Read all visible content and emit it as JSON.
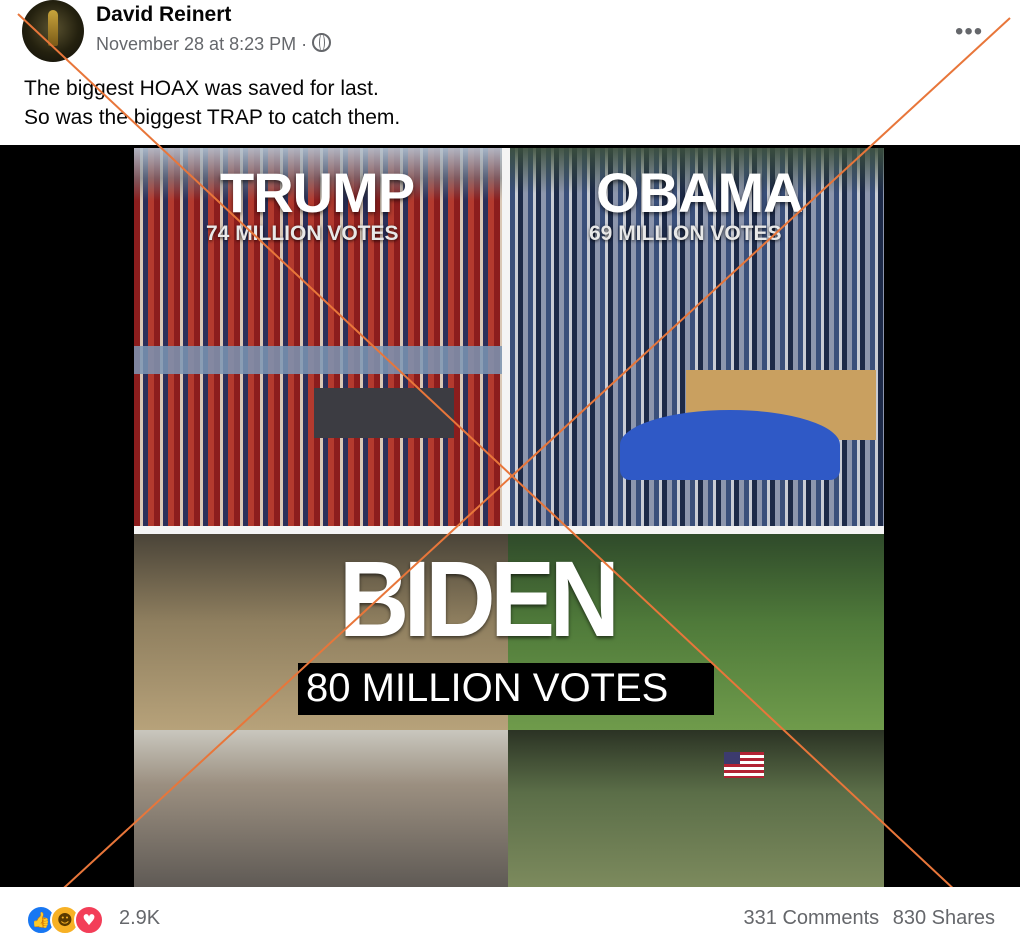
{
  "post": {
    "author": "David Reinert",
    "date": "November 28 at 8:23 PM",
    "separator": "·",
    "more_glyph": "•••",
    "caption_line1": "The biggest HOAX was saved for last.",
    "caption_line2": "So was the biggest TRAP to catch them."
  },
  "image": {
    "trump_title": "TRUMP",
    "trump_sub": "74 MILLION VOTES",
    "obama_title": "OBAMA",
    "obama_sub": "69 MILLION VOTES",
    "biden_title": "BIDEN",
    "biden_sub": "80 MILLION VOTES"
  },
  "footer": {
    "reaction_count": "2.9K",
    "comments": "331 Comments",
    "shares": "830 Shares",
    "reactions": [
      "like-icon",
      "haha-icon",
      "love-icon"
    ]
  },
  "colors": {
    "name": "#050505",
    "meta": "#65676b",
    "like": "#1877f2",
    "haha": "#f7b125",
    "love": "#f33e58",
    "cross": "#e8763a"
  }
}
